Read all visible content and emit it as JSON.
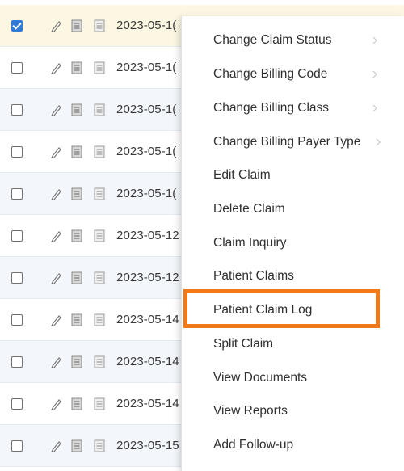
{
  "rows": [
    {
      "date": "2023-05-1(",
      "checked": true
    },
    {
      "date": "2023-05-1(",
      "checked": false
    },
    {
      "date": "2023-05-1(",
      "checked": false
    },
    {
      "date": "2023-05-1(",
      "checked": false
    },
    {
      "date": "2023-05-1(",
      "checked": false
    },
    {
      "date": "2023-05-12",
      "checked": false
    },
    {
      "date": "2023-05-12",
      "checked": false
    },
    {
      "date": "2023-05-14",
      "checked": false
    },
    {
      "date": "2023-05-14",
      "checked": false
    },
    {
      "date": "2023-05-14",
      "checked": false
    },
    {
      "date": "2023-05-15",
      "checked": false
    }
  ],
  "context_menu": {
    "items": [
      {
        "label": "Change Claim Status"
      },
      {
        "label": "Change Billing Code"
      },
      {
        "label": "Change Billing Class"
      },
      {
        "label": "Change Billing Payer Type"
      },
      {
        "label": "Edit Claim"
      },
      {
        "label": "Delete Claim"
      },
      {
        "label": "Claim Inquiry"
      },
      {
        "label": "Patient Claims"
      },
      {
        "label": "Patient Claim Log"
      },
      {
        "label": "Split Claim"
      },
      {
        "label": "View Documents"
      },
      {
        "label": "View Reports"
      },
      {
        "label": "Add Follow-up"
      }
    ]
  },
  "colors": {
    "highlight": "#f07a1a",
    "checkbox_checked": "#2f7bd8",
    "row_alt": "#f3f6fa",
    "row_selected": "#fbf7e3"
  }
}
